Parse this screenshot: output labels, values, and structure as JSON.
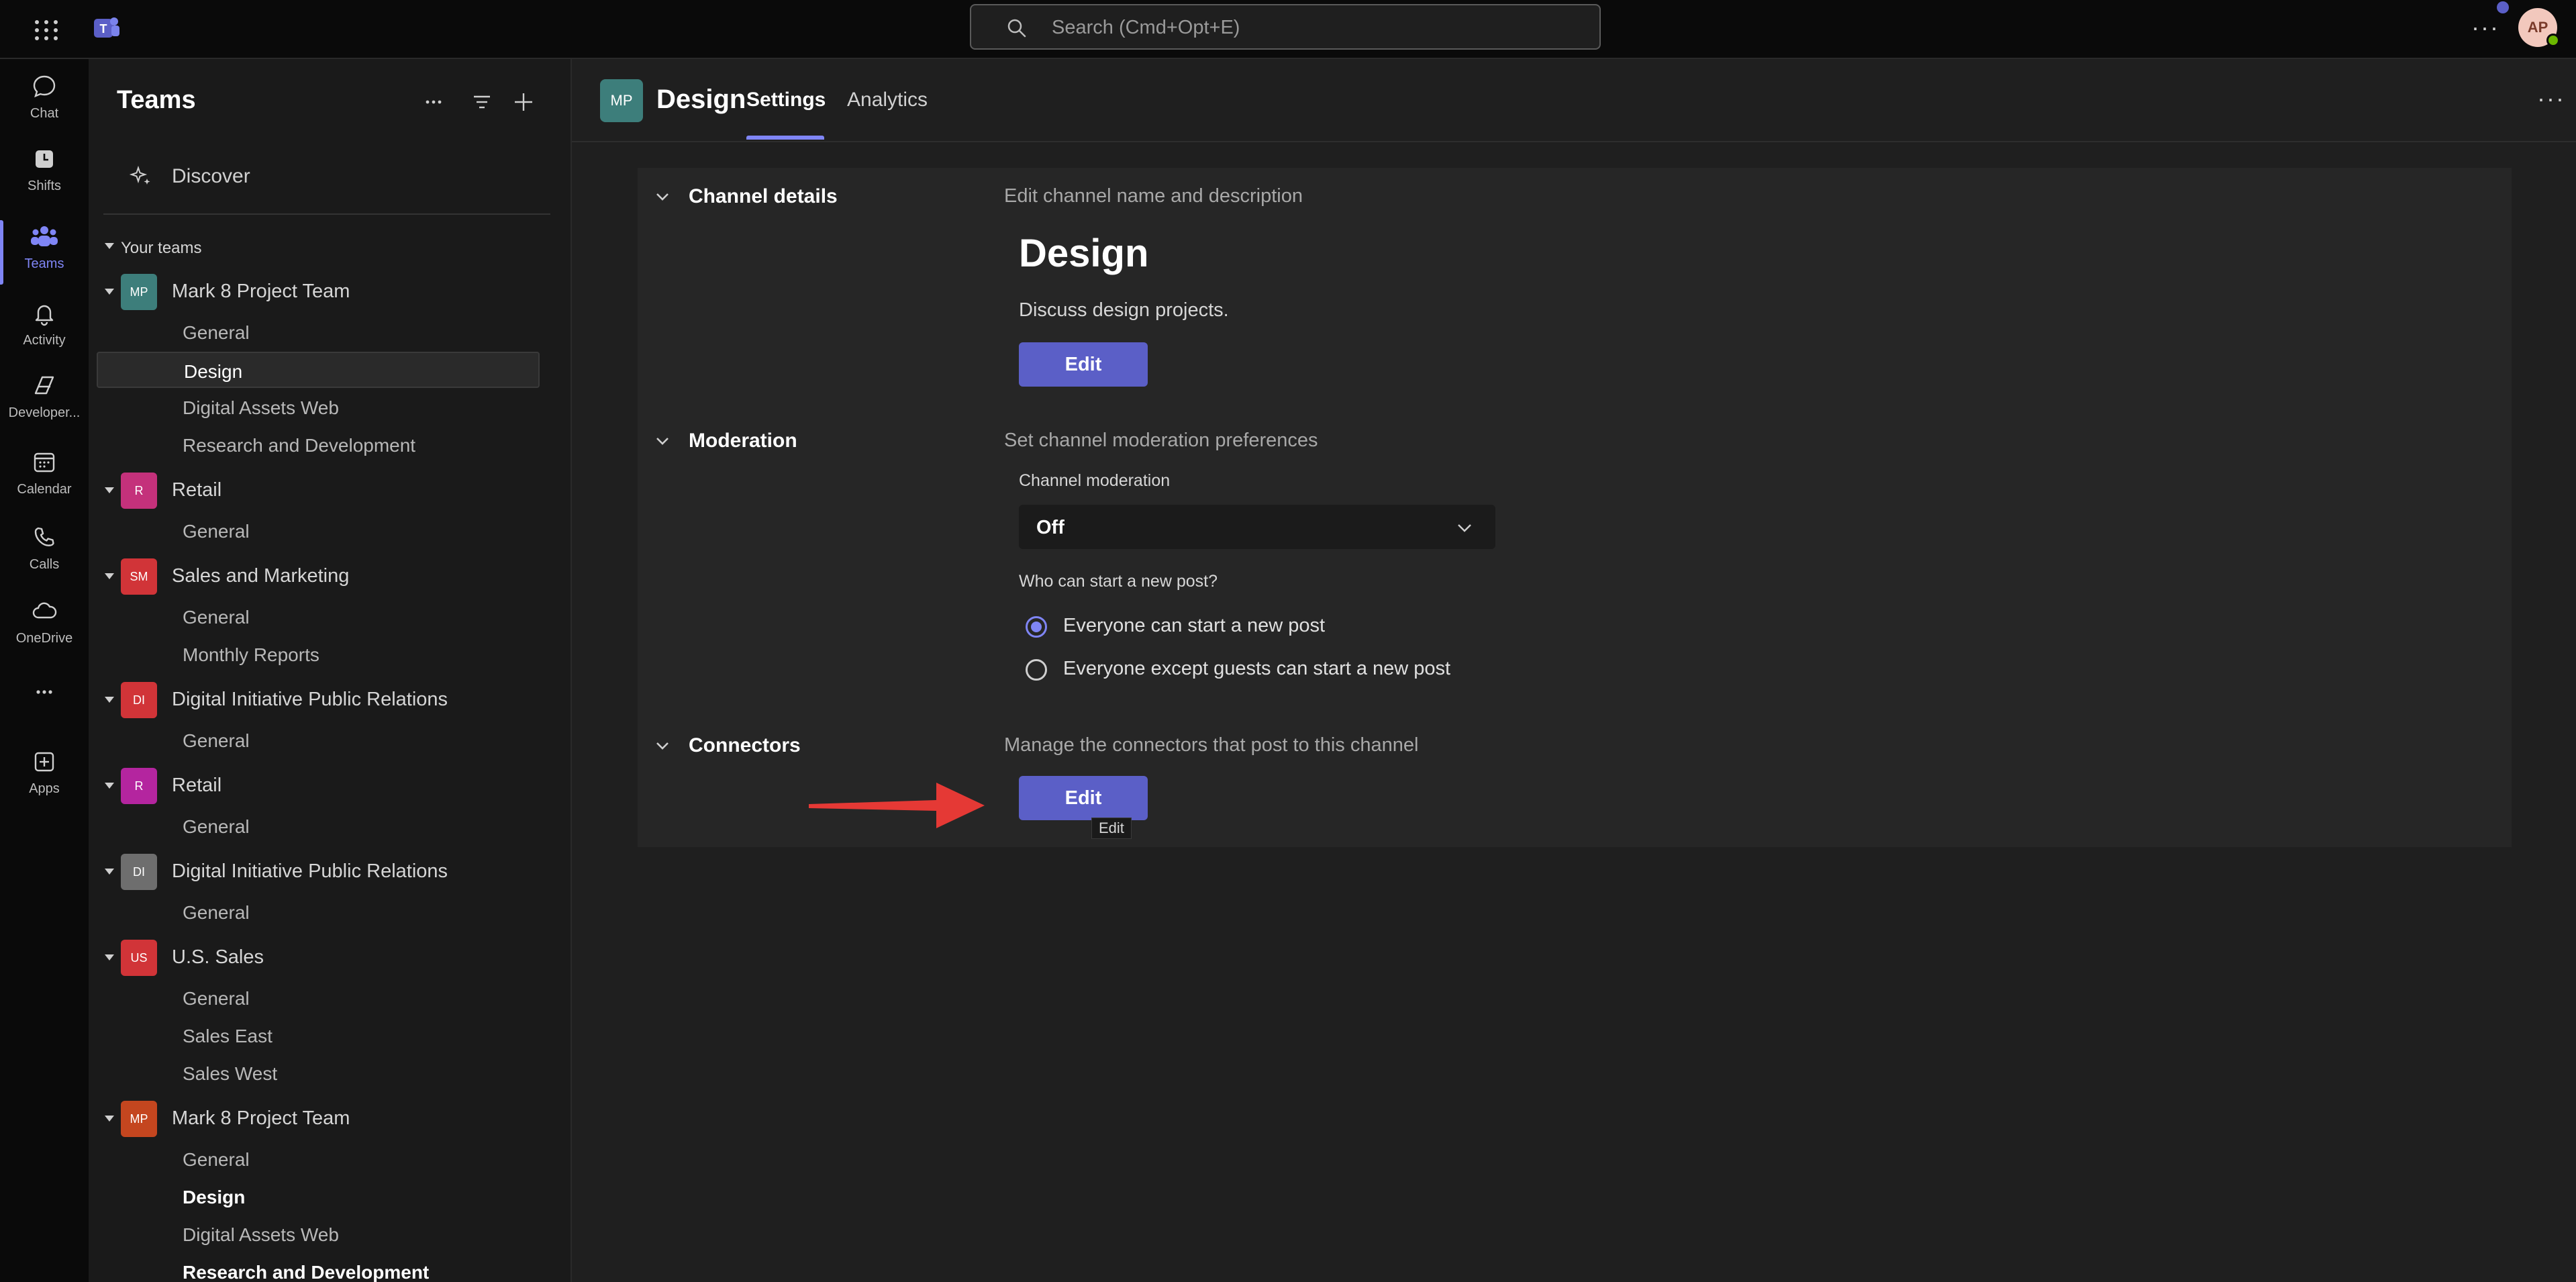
{
  "topbar": {
    "search_placeholder": "Search (Cmd+Opt+E)",
    "more": "···",
    "avatar_initials": "AP"
  },
  "rail": {
    "items": [
      {
        "label": "Chat",
        "icon": "chat-icon"
      },
      {
        "label": "Shifts",
        "icon": "shifts-icon"
      },
      {
        "label": "Teams",
        "icon": "teams-icon",
        "active": true
      },
      {
        "label": "Activity",
        "icon": "bell-icon"
      },
      {
        "label": "Developer...",
        "icon": "developer-icon"
      },
      {
        "label": "Calendar",
        "icon": "calendar-icon"
      },
      {
        "label": "Calls",
        "icon": "phone-icon"
      },
      {
        "label": "OneDrive",
        "icon": "cloud-icon"
      },
      {
        "label": "",
        "icon": "more-icon"
      },
      {
        "label": "Apps",
        "icon": "add-app-icon"
      }
    ]
  },
  "leftpanel": {
    "title": "Teams",
    "discover": "Discover",
    "your_teams": "Your teams",
    "teams": [
      {
        "initials": "MP",
        "name": "Mark 8 Project Team",
        "color": "#3d7e7b",
        "channels": [
          "General",
          "Design",
          "Digital Assets Web",
          "Research and Development"
        ]
      },
      {
        "initials": "R",
        "name": "Retail",
        "color": "#c4317b",
        "channels": [
          "General"
        ]
      },
      {
        "initials": "SM",
        "name": "Sales and Marketing",
        "color": "#d13438",
        "channels": [
          "General",
          "Monthly Reports"
        ]
      },
      {
        "initials": "DI",
        "name": "Digital Initiative Public Relations",
        "color": "#d13438",
        "channels": [
          "General"
        ]
      },
      {
        "initials": "R",
        "name": "Retail",
        "color": "#b4259f",
        "channels": [
          "General"
        ]
      },
      {
        "initials": "DI",
        "name": "Digital Initiative Public Relations",
        "color": "#6e6e6e",
        "channels": [
          "General"
        ]
      },
      {
        "initials": "US",
        "name": "U.S. Sales",
        "color": "#d13438",
        "channels": [
          "General",
          "Sales East",
          "Sales West"
        ]
      },
      {
        "initials": "MP",
        "name": "Mark 8 Project Team",
        "color": "#c4461f",
        "channels": [
          "General",
          "Design",
          "Digital Assets Web",
          "Research and Development"
        ]
      }
    ]
  },
  "channel": {
    "avatar": "MP",
    "name": "Design",
    "tabs": [
      "Settings",
      "Analytics"
    ],
    "more": "···"
  },
  "settings": {
    "details": {
      "title": "Channel details",
      "desc": "Edit channel name and description",
      "channel_name": "Design",
      "channel_desc": "Discuss design projects.",
      "edit": "Edit"
    },
    "moderation": {
      "title": "Moderation",
      "desc": "Set channel moderation preferences",
      "label": "Channel moderation",
      "value": "Off",
      "who_label": "Who can start a new post?",
      "options": [
        "Everyone can start a new post",
        "Everyone except guests can start a new post"
      ],
      "selected": 0
    },
    "connectors": {
      "title": "Connectors",
      "desc": "Manage the connectors that post to this channel",
      "edit": "Edit",
      "tooltip": "Edit"
    }
  },
  "colors": {
    "accent": "#5b5fc7",
    "accent_light": "#7f85f5",
    "arrow": "#e53935"
  }
}
